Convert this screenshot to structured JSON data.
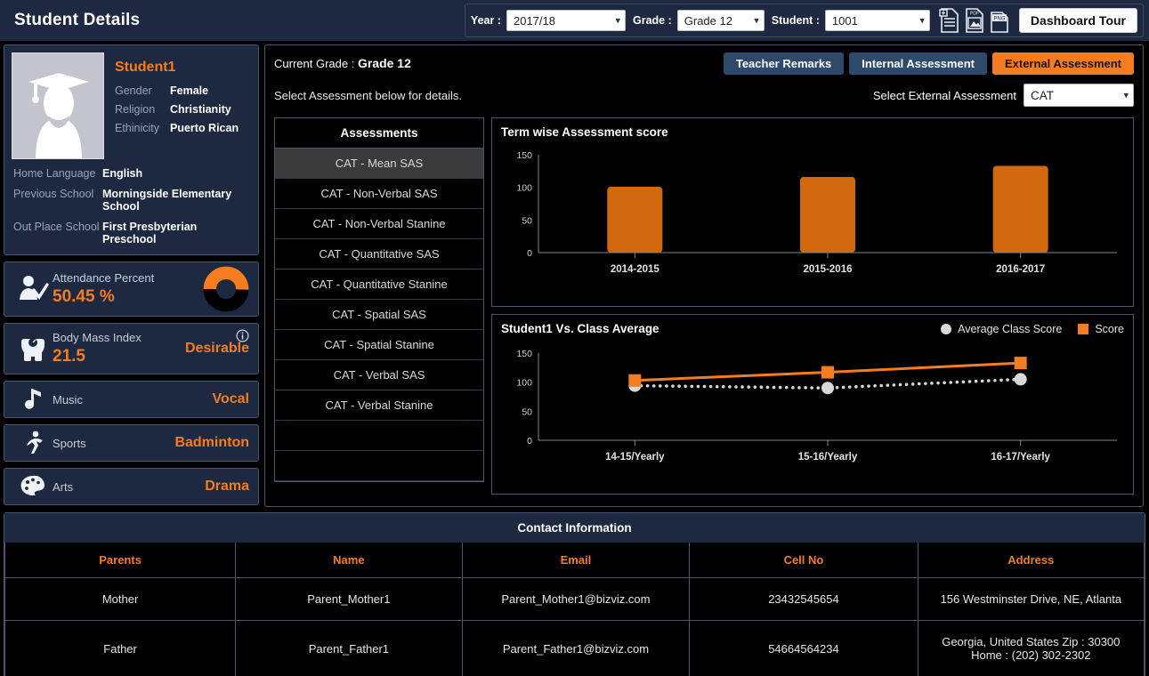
{
  "header": {
    "title": "Student Details",
    "year_label": "Year :",
    "year_value": "2017/18",
    "grade_label": "Grade :",
    "grade_value": "Grade 12",
    "student_label": "Student :",
    "student_value": "1001",
    "tour_button": "Dashboard Tour",
    "icons": [
      "document-add-icon",
      "pdf-export-icon",
      "png-export-icon"
    ]
  },
  "profile": {
    "name": "Student1",
    "fields": [
      {
        "key": "Gender",
        "value": "Female"
      },
      {
        "key": "Religion",
        "value": "Christianity"
      },
      {
        "key": "Ethinicity",
        "value": "Puerto Rican"
      }
    ],
    "extra": [
      {
        "key": "Home Language",
        "value": "English"
      },
      {
        "key": "Previous School",
        "value": "Morningside Elementary School"
      },
      {
        "key": "Out Place School",
        "value": "First Presbyterian Preschool"
      }
    ]
  },
  "stats": {
    "attendance": {
      "title": "Attendance  Percent",
      "value": "50.45 %",
      "percent": 50.45
    },
    "bmi": {
      "title": "Body Mass Index",
      "value": "21.5",
      "status": "Desirable"
    },
    "music": {
      "title": "Music",
      "value": "Vocal"
    },
    "sports": {
      "title": "Sports",
      "value": "Badminton"
    },
    "arts": {
      "title": "Arts",
      "value": "Drama"
    }
  },
  "main": {
    "current_grade_label": "Current Grade :",
    "current_grade_value": "Grade 12",
    "select_hint": "Select Assessment below for details.",
    "tabs": [
      {
        "label": "Teacher Remarks",
        "active": false
      },
      {
        "label": "Internal Assessment",
        "active": false
      },
      {
        "label": "External Assessment",
        "active": true
      }
    ],
    "external_label": "Select External Assessment",
    "external_value": "CAT"
  },
  "assessments": {
    "header": "Assessments",
    "items": [
      "CAT - Mean SAS",
      "CAT - Non-Verbal SAS",
      "CAT - Non-Verbal Stanine",
      "CAT - Quantitative SAS",
      "CAT - Quantitative Stanine",
      "CAT - Spatial SAS",
      "CAT - Spatial Stanine",
      "CAT - Verbal SAS",
      "CAT - Verbal Stanine"
    ],
    "selected": "CAT - Mean SAS"
  },
  "colors": {
    "accent_orange": "#f57c1f",
    "bar_orange": "#d2690f",
    "panel_navy": "#1c2940",
    "tab_blue": "#2d4a6b",
    "background": "#000000",
    "border": "#4a586e"
  },
  "chart_data": [
    {
      "type": "bar",
      "title": "Term wise Assessment score",
      "categories": [
        "2014-2015",
        "2015-2016",
        "2016-2017"
      ],
      "values": [
        101,
        116,
        133
      ],
      "xlabel": "",
      "ylabel": "",
      "ylim": [
        0,
        150
      ],
      "yticks": [
        0,
        50,
        100,
        150
      ],
      "grid": false,
      "legend": "none"
    },
    {
      "type": "line",
      "title": "Student1  Vs. Class Average",
      "x": [
        "14-15/Yearly",
        "15-16/Yearly",
        "16-17/Yearly"
      ],
      "series": [
        {
          "name": "Average Class Score",
          "values": [
            94,
            90,
            105
          ],
          "marker": "circle",
          "color": "#d9d9d9",
          "style": "dotted"
        },
        {
          "name": "Score",
          "values": [
            103,
            117,
            133
          ],
          "marker": "square",
          "color": "#f57c1f",
          "style": "solid"
        }
      ],
      "xlabel": "",
      "ylabel": "",
      "ylim": [
        0,
        150
      ],
      "yticks": [
        0,
        50,
        100,
        150
      ],
      "grid": false,
      "legend": "top-right"
    }
  ],
  "contact": {
    "title": "Contact Information",
    "columns": [
      "Parents",
      "Name",
      "Email",
      "Cell No",
      "Address"
    ],
    "rows": [
      {
        "parents": "Mother",
        "name": "Parent_Mother1",
        "email": "Parent_Mother1@bizviz.com",
        "cell": "23432545654",
        "address": "156 Westminster Drive, NE, Atlanta"
      },
      {
        "parents": "Father",
        "name": "Parent_Father1",
        "email": "Parent_Father1@bizviz.com",
        "cell": "54664564234",
        "address": "Georgia, United States Zip : 30300 Home : (202) 302-2302"
      }
    ]
  }
}
